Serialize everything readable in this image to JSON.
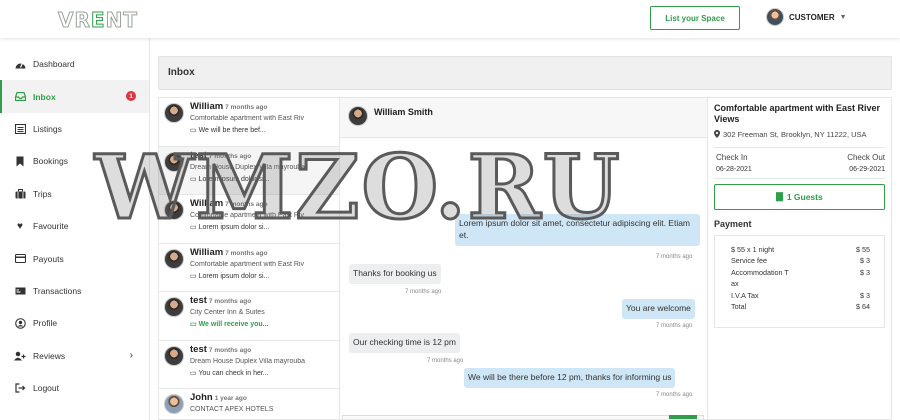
{
  "header": {
    "logo_prefix": "VR",
    "logo_accent": "E",
    "logo_suffix": "NT",
    "list_space_label": "List your Space",
    "user_label": "CUSTOMER"
  },
  "sidebar": {
    "items": [
      {
        "label": "Dashboard",
        "icon": "dashboard-icon"
      },
      {
        "label": "Inbox",
        "icon": "inbox-icon",
        "badge": "1",
        "active": true
      },
      {
        "label": "Listings",
        "icon": "list-icon"
      },
      {
        "label": "Bookings",
        "icon": "bookmark-icon"
      },
      {
        "label": "Trips",
        "icon": "suitcase-icon"
      },
      {
        "label": "Favourite",
        "icon": "heart-icon"
      },
      {
        "label": "Payouts",
        "icon": "credit-card-icon"
      },
      {
        "label": "Transactions",
        "icon": "money-icon"
      },
      {
        "label": "Profile",
        "icon": "user-circle-icon"
      },
      {
        "label": "Reviews",
        "icon": "users-icon",
        "has_chevron": true
      },
      {
        "label": "Logout",
        "icon": "logout-icon"
      }
    ]
  },
  "inbox": {
    "title": "Inbox",
    "conversations": [
      {
        "name": "William",
        "time": "7 months ago",
        "property": "Comfortable apartment with East Riv",
        "message": "We will be there bef..."
      },
      {
        "name": "test",
        "time": "7 months ago",
        "property": "Dream House Duplex Villa mayrouba",
        "message": "Lorem ipsum dolor si...",
        "active": true
      },
      {
        "name": "William",
        "time": "7 months ago",
        "property": "Comfortable apartment with East Riv",
        "message": "Lorem ipsum dolor si..."
      },
      {
        "name": "William",
        "time": "7 months ago",
        "property": "Comfortable apartment with East Riv",
        "message": "Lorem ipsum dolor si..."
      },
      {
        "name": "test",
        "time": "7 months ago",
        "property": "City Center Inn & Suites",
        "message": "We will receive you...",
        "unread": true
      },
      {
        "name": "test",
        "time": "7 months ago",
        "property": "Dream House Duplex Villa mayrouba",
        "message": "You can check in her..."
      },
      {
        "name": "John",
        "time": "1 year ago",
        "property": "CONTACT APEX HOTELS",
        "message": ""
      }
    ]
  },
  "chat": {
    "contact_name": "William Smith",
    "messages": [
      {
        "text": "Lorem ipsum dolor sit amet, consectetur adipiscing elit. Etiam et.",
        "time": "7 months ago",
        "dir": "out"
      },
      {
        "text": "Thanks for booking us",
        "time": "7 months ago",
        "dir": "in"
      },
      {
        "text": "You are welcome",
        "time": "7 months ago",
        "dir": "out"
      },
      {
        "text": "Our checking time is 12 pm",
        "time": "7 months ago",
        "dir": "in"
      },
      {
        "text": "We will be there before 12 pm, thanks for informing us",
        "time": "7 months ago",
        "dir": "out"
      }
    ]
  },
  "details": {
    "property_title": "Comfortable apartment with East River Views",
    "address": "302 Freeman St, Brooklyn, NY 11222, USA",
    "check_in_label": "Check In",
    "check_in_date": "06-28-2021",
    "check_out_label": "Check Out",
    "check_out_date": "06-29-2021",
    "guests_label": "1 Guests",
    "payment_label": "Payment",
    "payment_rows": [
      {
        "label": "$ 55 x 1 night",
        "value": "$ 55"
      },
      {
        "label": "Service fee",
        "value": "$ 3"
      },
      {
        "label": "Accommodation Tax",
        "value": "$ 3"
      },
      {
        "label": "I.V.A Tax",
        "value": "$ 3"
      },
      {
        "label": "Total",
        "value": "$ 64"
      }
    ]
  },
  "watermark": "WMZO.RU",
  "colors": {
    "accent": "#2e9e4a",
    "badge": "#dc3545",
    "bubble_out": "#cfe6f6",
    "bubble_in": "#eceeef"
  }
}
